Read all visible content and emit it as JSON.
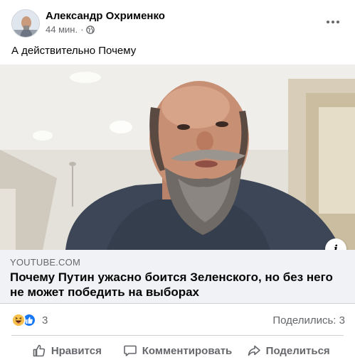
{
  "post": {
    "author": "Александр Охрименко",
    "time": "44 мин.",
    "separator": "·",
    "privacy_icon": "globe-icon",
    "text": "А действительно Почему"
  },
  "link": {
    "domain": "YOUTUBE.COM",
    "title": "Почему Путин ужасно боится Зеленского, но без него не может победить на выборах",
    "info_icon_label": "i"
  },
  "reactions": {
    "icons": [
      "haha-icon",
      "like-icon"
    ],
    "count": "3"
  },
  "shares": {
    "label": "Поделились: 3"
  },
  "actions": {
    "like": "Нравится",
    "comment": "Комментировать",
    "share": "Поделиться"
  },
  "colors": {
    "accent": "#1877f2",
    "secondary_text": "#65676b",
    "link_bg": "#f0f2f5"
  }
}
